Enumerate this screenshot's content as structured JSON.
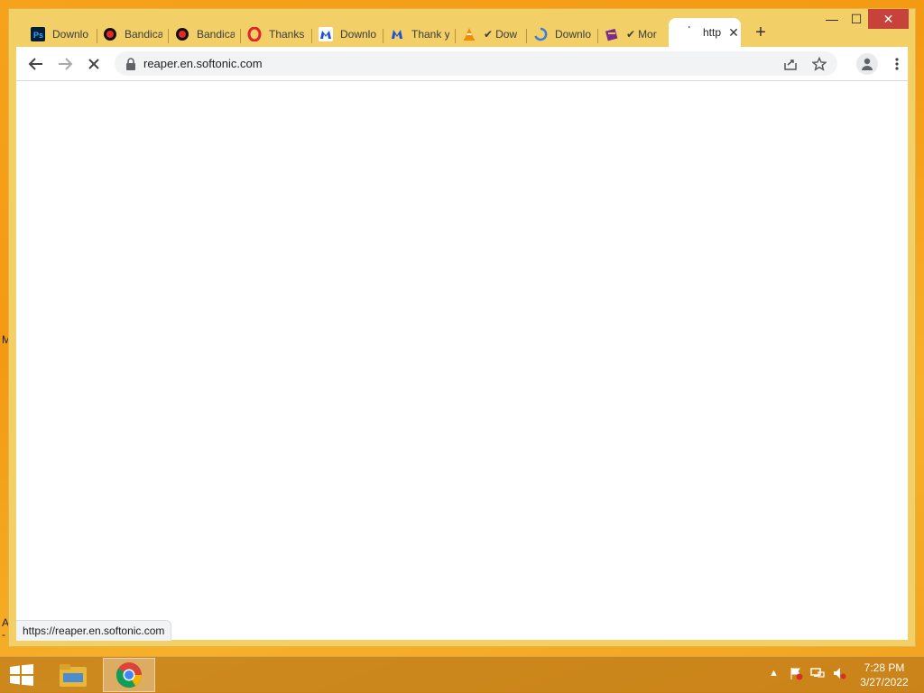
{
  "browser": {
    "tabs": [
      {
        "label": "Downlo",
        "icon": "photoshop-icon"
      },
      {
        "label": "Bandica",
        "icon": "bandicam-icon"
      },
      {
        "label": "Bandica",
        "icon": "bandicam-icon"
      },
      {
        "label": "Thanks",
        "icon": "opera-icon"
      },
      {
        "label": "Downlo",
        "icon": "malwarebytes-icon"
      },
      {
        "label": "Thank y",
        "icon": "malwarebytes-icon"
      },
      {
        "label": "Dow",
        "icon": "vlc-icon",
        "prefix": "✔"
      },
      {
        "label": "Downlo",
        "icon": "loading-ring-icon"
      },
      {
        "label": "Mor",
        "icon": "winrar-icon",
        "prefix": "✔"
      },
      {
        "label": "http",
        "icon": "loading-icon",
        "active": true
      }
    ],
    "new_tab": "+",
    "window_controls": {
      "minimize": "—",
      "maximize": "☐",
      "close": "✕"
    },
    "address_url": "reaper.en.softonic.com",
    "status_url": "https://reaper.en.softonic.com"
  },
  "desktop": {
    "edge_labels": [
      "M",
      "A",
      "-"
    ]
  },
  "taskbar": {
    "clock_time": "7:28 PM",
    "clock_date": "3/27/2022"
  },
  "colors": {
    "desktop": "#f39a12",
    "frame": "#f2cf67",
    "close_button": "#c7423b"
  }
}
